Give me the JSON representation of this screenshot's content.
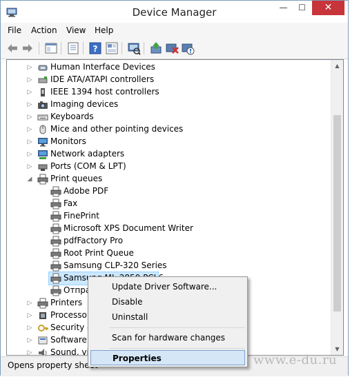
{
  "window": {
    "title": "Device Manager",
    "controls": {
      "minimize": "—",
      "maximize": "☐",
      "close": "✕"
    }
  },
  "menubar": {
    "items": [
      "File",
      "Action",
      "View",
      "Help"
    ]
  },
  "toolbar": {
    "buttons": [
      "back-icon",
      "forward-icon",
      "show-hide-console-tree-icon",
      "properties-icon",
      "help-icon",
      "view-icon",
      "scan-hardware-icon",
      "update-driver-icon",
      "uninstall-icon",
      "disable-icon"
    ]
  },
  "tree": {
    "rows": [
      {
        "label": "Human Interface Devices",
        "icon": "hid-icon",
        "expanded": false,
        "level": 0
      },
      {
        "label": "IDE ATA/ATAPI controllers",
        "icon": "ide-controller-icon",
        "expanded": false,
        "level": 0
      },
      {
        "label": "IEEE 1394 host controllers",
        "icon": "ieee1394-icon",
        "expanded": false,
        "level": 0
      },
      {
        "label": "Imaging devices",
        "icon": "camera-icon",
        "expanded": false,
        "level": 0
      },
      {
        "label": "Keyboards",
        "icon": "keyboard-icon",
        "expanded": false,
        "level": 0
      },
      {
        "label": "Mice and other pointing devices",
        "icon": "mouse-icon",
        "expanded": false,
        "level": 0
      },
      {
        "label": "Monitors",
        "icon": "monitor-icon",
        "expanded": false,
        "level": 0
      },
      {
        "label": "Network adapters",
        "icon": "network-adapter-icon",
        "expanded": false,
        "level": 0
      },
      {
        "label": "Ports (COM & LPT)",
        "icon": "port-icon",
        "expanded": false,
        "level": 0
      },
      {
        "label": "Print queues",
        "icon": "printer-icon",
        "expanded": true,
        "level": 0
      },
      {
        "label": "Adobe PDF",
        "icon": "printer-icon",
        "level": 1
      },
      {
        "label": "Fax",
        "icon": "printer-icon",
        "level": 1
      },
      {
        "label": "FinePrint",
        "icon": "printer-icon",
        "level": 1
      },
      {
        "label": "Microsoft XPS Document Writer",
        "icon": "printer-icon",
        "level": 1
      },
      {
        "label": "pdfFactory Pro",
        "icon": "printer-icon",
        "level": 1
      },
      {
        "label": "Root Print Queue",
        "icon": "printer-icon",
        "level": 1
      },
      {
        "label": "Samsung CLP-320 Series",
        "icon": "printer-icon",
        "level": 1
      },
      {
        "label": "Samsung ML-2850 PCL6",
        "icon": "printer-icon",
        "level": 1,
        "selected": true
      },
      {
        "label": "Отпра",
        "icon": "printer-icon",
        "level": 1
      },
      {
        "label": "Printers",
        "icon": "printer-icon",
        "expanded": false,
        "level": 0
      },
      {
        "label": "Processors",
        "icon": "processor-icon",
        "expanded": false,
        "level": 0
      },
      {
        "label": "Security d",
        "icon": "security-device-icon",
        "expanded": false,
        "level": 0
      },
      {
        "label": "Software d",
        "icon": "software-device-icon",
        "expanded": false,
        "level": 0
      },
      {
        "label": "Sound, vid",
        "icon": "sound-icon",
        "expanded": false,
        "level": 0
      }
    ]
  },
  "context_menu": {
    "items": [
      {
        "label": "Update Driver Software...",
        "bold": false
      },
      {
        "label": "Disable",
        "bold": false
      },
      {
        "label": "Uninstall",
        "bold": false
      },
      {
        "separator": true
      },
      {
        "label": "Scan for hardware changes",
        "bold": false
      },
      {
        "separator": true
      },
      {
        "label": "Properties",
        "bold": true,
        "highlighted": true
      }
    ]
  },
  "statusbar": {
    "text": "Opens property sheet"
  },
  "watermark": "www.e-du.ru",
  "colors": {
    "close_button": "#c7343a",
    "selection": "#cce8ff",
    "menu_highlight": "#d5e6f7"
  }
}
